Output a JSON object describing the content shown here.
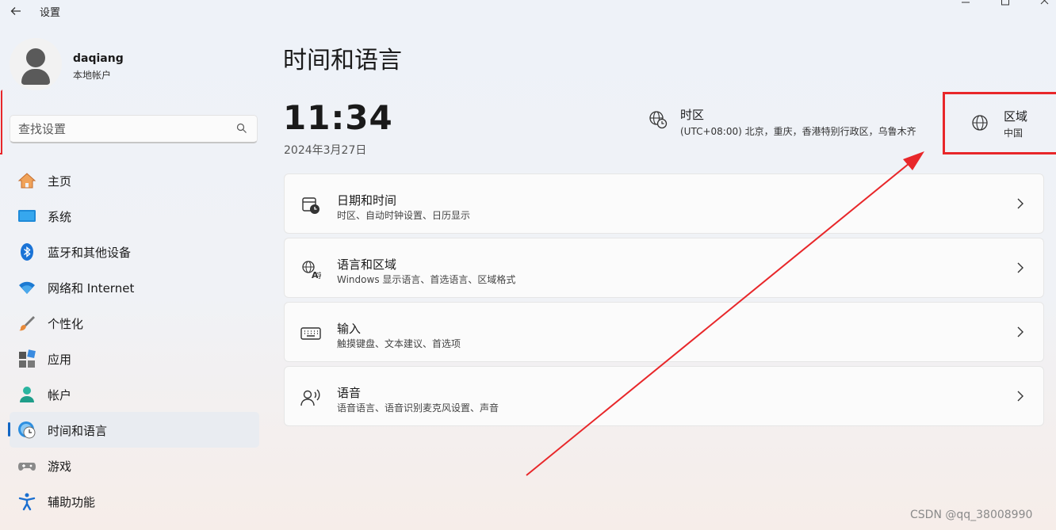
{
  "window": {
    "back_icon": "arrow-left-icon",
    "title": "设置",
    "controls": [
      "minimize",
      "maximize",
      "close"
    ]
  },
  "profile": {
    "name": "daqiang",
    "account_type": "本地帐户"
  },
  "search": {
    "placeholder": "查找设置"
  },
  "sidebar": {
    "items": [
      {
        "label": "主页",
        "icon": "home-icon"
      },
      {
        "label": "系统",
        "icon": "monitor-icon"
      },
      {
        "label": "蓝牙和其他设备",
        "icon": "bluetooth-icon"
      },
      {
        "label": "网络和 Internet",
        "icon": "wifi-icon"
      },
      {
        "label": "个性化",
        "icon": "brush-icon"
      },
      {
        "label": "应用",
        "icon": "apps-icon"
      },
      {
        "label": "帐户",
        "icon": "person-icon"
      },
      {
        "label": "时间和语言",
        "icon": "globe-clock-icon",
        "active": true
      },
      {
        "label": "游戏",
        "icon": "gamepad-icon"
      },
      {
        "label": "辅助功能",
        "icon": "accessibility-icon"
      }
    ]
  },
  "main": {
    "title": "时间和语言",
    "time": "11:34",
    "date": "2024年3月27日",
    "timezone": {
      "title": "时区",
      "value": "(UTC+08:00) 北京，重庆，香港特别行政区，乌鲁木齐"
    },
    "region": {
      "title": "区域",
      "value": "中国"
    },
    "cards": [
      {
        "title": "日期和时间",
        "subtitle": "时区、自动时钟设置、日历显示",
        "icon": "calendar-clock-icon"
      },
      {
        "title": "语言和区域",
        "subtitle": "Windows 显示语言、首选语言、区域格式",
        "icon": "language-icon"
      },
      {
        "title": "输入",
        "subtitle": "触摸键盘、文本建议、首选项",
        "icon": "keyboard-icon"
      },
      {
        "title": "语音",
        "subtitle": "语音语言、语音识别麦克风设置、声音",
        "icon": "speech-icon"
      }
    ]
  },
  "annotation": {
    "color": "#e8272a"
  },
  "watermark": "CSDN @qq_38008990"
}
